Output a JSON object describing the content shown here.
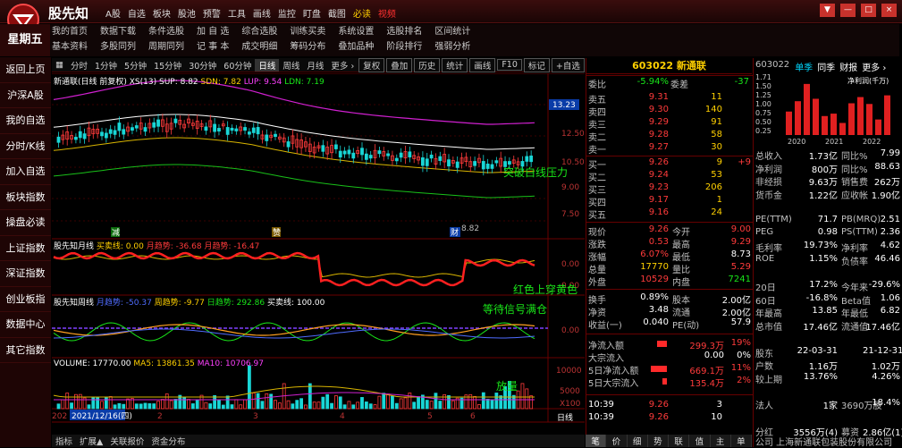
{
  "app": {
    "brand": "股先知",
    "top_menu": [
      "A股",
      "自选",
      "板块",
      "股池",
      "预警",
      "工具",
      "画线",
      "监控",
      "盯盘",
      "截图",
      "必读",
      "视频"
    ],
    "window_buttons": [
      "▼",
      "—",
      "□",
      "×"
    ]
  },
  "weekday": "星期五",
  "submenu": {
    "row1": [
      "我的首页",
      "数据下载",
      "条件选股",
      "加 自 选",
      "综合选股",
      "训练买卖",
      "系统设置",
      "选股排名",
      "区间统计"
    ],
    "row2": [
      "基本资料",
      "多股同列",
      "周期同列",
      "记 事 本",
      "成交明细",
      "筹码分布",
      "叠加品种",
      "阶段排行",
      "强弱分析"
    ]
  },
  "sidebar": [
    "返回上页",
    "沪深A股",
    "我的自选",
    "分时/K线",
    "加入自选",
    "板块指数",
    "操盘必读",
    "上证指数",
    "深证指数",
    "创业板指",
    "数据中心",
    "其它指数"
  ],
  "period_bar": {
    "items": [
      "分时",
      "1分钟",
      "5分钟",
      "15分钟",
      "30分钟",
      "60分钟",
      "日线",
      "周线",
      "月线",
      "更多 ›"
    ],
    "active": "日线",
    "buttons": [
      "复权",
      "叠加",
      "历史",
      "统计",
      "画线",
      "F10",
      "标记",
      "+自选"
    ]
  },
  "main_chart": {
    "title": "新通联(日线 前复权)",
    "indicators": [
      {
        "label": "XS(13)",
        "color": "#ffffff"
      },
      {
        "label": "SUP: 8.82",
        "color": "#ffffff"
      },
      {
        "label": "SDN: 7.82",
        "color": "#ffd000"
      },
      {
        "label": "LUP: 9.54",
        "color": "#ff40ff"
      },
      {
        "label": "LDN: 7.19",
        "color": "#19e619"
      }
    ],
    "price_labels": [
      "13.23",
      "12.50",
      "10.50",
      "9.00",
      "7.50"
    ],
    "annotations": {
      "breakout": "突破白线压力",
      "buy_mark": "减",
      "sell_mark": "赞",
      "low_mark": "8.82",
      "bottom_tag": "财"
    }
  },
  "panel1": {
    "title": "股先知月线",
    "items": [
      {
        "label": "买卖线: 0.00",
        "color": "#ffd000"
      },
      {
        "label": "月趋势: -36.68",
        "color": "#ff3b3b"
      },
      {
        "label": "月趋势: -16.47",
        "color": "#ff3b3b"
      }
    ],
    "axis": [
      "0.00",
      "0.00"
    ],
    "annotation": "红色上穿黄色"
  },
  "panel2": {
    "title": "股先知周线",
    "items": [
      {
        "label": "月趋势: -50.37",
        "color": "#4f6cff"
      },
      {
        "label": "周趋势: -9.77",
        "color": "#ffd000"
      },
      {
        "label": "日趋势: 292.86",
        "color": "#19e619"
      },
      {
        "label": "买卖线: 100.00",
        "color": "#ffffff"
      }
    ],
    "axis": [
      "0.00"
    ],
    "annotation": "等待信号满仓"
  },
  "panel3": {
    "title": "VOLUME: 17770.00",
    "items": [
      {
        "label": "MA5: 13861.35",
        "color": "#ffd000"
      },
      {
        "label": "MA10: 10706.97",
        "color": "#ff40ff"
      }
    ],
    "axis": [
      "10000",
      "5000",
      "X100"
    ],
    "annotation": "放量"
  },
  "date_axis": {
    "start": "2021/12/16(四)",
    "labels": [
      "2",
      "3",
      "4",
      "5",
      "6"
    ],
    "period": "日线",
    "year_prefix": "202"
  },
  "bottom_tabs": [
    "指标",
    "扩展▲",
    "关联报价",
    "资金分布"
  ],
  "quote": {
    "code": "603022",
    "name": "新通联",
    "webi_label": "委比",
    "webi_value": "-5.94%",
    "weicha_label": "委差",
    "weicha_value": "-37",
    "sells": [
      {
        "label": "卖五",
        "price": "9.31",
        "vol": "11"
      },
      {
        "label": "卖四",
        "price": "9.30",
        "vol": "140"
      },
      {
        "label": "卖三",
        "price": "9.29",
        "vol": "91"
      },
      {
        "label": "卖二",
        "price": "9.28",
        "vol": "58"
      },
      {
        "label": "卖一",
        "price": "9.27",
        "vol": "30"
      }
    ],
    "buys": [
      {
        "label": "买一",
        "price": "9.26",
        "vol": "9",
        "extra": "+9"
      },
      {
        "label": "买二",
        "price": "9.24",
        "vol": "53",
        "extra": ""
      },
      {
        "label": "买三",
        "price": "9.23",
        "vol": "206",
        "extra": ""
      },
      {
        "label": "买四",
        "price": "9.17",
        "vol": "1",
        "extra": ""
      },
      {
        "label": "买五",
        "price": "9.16",
        "vol": "24",
        "extra": ""
      }
    ],
    "stats": [
      {
        "l1": "现价",
        "v1": "9.26",
        "l2": "今开",
        "v2": "9.00",
        "c1": "red",
        "c2": "red"
      },
      {
        "l1": "涨跌",
        "v1": "0.53",
        "l2": "最高",
        "v2": "9.29",
        "c1": "red",
        "c2": "red"
      },
      {
        "l1": "涨幅",
        "v1": "6.07%",
        "l2": "最低",
        "v2": "8.73",
        "c1": "red",
        "c2": "wht"
      },
      {
        "l1": "总量",
        "v1": "17770",
        "l2": "量比",
        "v2": "5.29",
        "c1": "yel",
        "c2": "red"
      },
      {
        "l1": "外盘",
        "v1": "10529",
        "l2": "内盘",
        "v2": "7241",
        "c1": "red",
        "c2": "green"
      }
    ],
    "stats2": [
      {
        "l1": "换手",
        "v1": "0.89%",
        "l2": "股本",
        "v2": "2.00亿"
      },
      {
        "l1": "净资",
        "v1": "3.48",
        "l2": "流通",
        "v2": "2.00亿"
      },
      {
        "l1": "收益(一)",
        "v1": "0.040",
        "l2": "PE(动)",
        "v2": "57.9"
      }
    ],
    "flows": [
      {
        "label": "净流入额",
        "value": "299.3万",
        "pct": "19%",
        "bar": 0.6,
        "color": "red"
      },
      {
        "label": "大宗流入",
        "value": "0.00",
        "pct": "0%",
        "bar": 0,
        "color": "wht"
      },
      {
        "label": "5日净流入额",
        "value": "669.1万",
        "pct": "11%",
        "bar": 1.0,
        "color": "red"
      },
      {
        "label": "5日大宗流入",
        "value": "135.4万",
        "pct": "2%",
        "bar": 0.25,
        "color": "red"
      }
    ],
    "ticks": [
      {
        "time": "10:39",
        "price": "9.26",
        "vol": "3"
      },
      {
        "time": "10:39",
        "price": "9.26",
        "vol": "10"
      }
    ],
    "tabs": [
      "笔",
      "价",
      "细",
      "势",
      "联",
      "值",
      "主",
      "单"
    ],
    "active_tab": "笔"
  },
  "finance": {
    "code": "603022",
    "tabs": [
      "单季",
      "同季",
      "财报",
      "更多 ›"
    ],
    "chart_label": "净利润(千万)",
    "chart_data": {
      "type": "bar",
      "ylim": [
        0,
        1.71
      ],
      "y_ticks": [
        "1.71",
        "1.50",
        "1.25",
        "1.00",
        "0.75",
        "0.50",
        "0.25"
      ],
      "x_ticks": [
        "2020",
        "2021",
        "2022"
      ],
      "values": [
        0.68,
        0.98,
        1.48,
        1.05,
        0.55,
        0.62,
        0.35,
        0.92,
        1.1,
        0.9,
        0.45,
        1.15
      ]
    },
    "rows": [
      {
        "l1": "总收入",
        "v1": "1.73亿",
        "l2": "同比%",
        "v2": "7.99"
      },
      {
        "l1": "净利润",
        "v1": "800万",
        "l2": "同比%",
        "v2": "88.63"
      },
      {
        "l1": "非经损",
        "v1": "9.63万",
        "l2": "销售费",
        "v2": "262万"
      },
      {
        "l1": "货币金",
        "v1": "1.22亿",
        "l2": "应收帐",
        "v2": "1.90亿"
      },
      {
        "l1": "",
        "v1": "",
        "l2": "",
        "v2": ""
      },
      {
        "l1": "PE(TTM)",
        "v1": "71.7",
        "l2": "PB(MRQ)",
        "v2": "2.51"
      },
      {
        "l1": "PEG",
        "v1": "0.98",
        "l2": "PS(TTM)",
        "v2": "2.36"
      },
      {
        "l1": "毛利率",
        "v1": "19.73%",
        "l2": "净利率",
        "v2": "4.62"
      },
      {
        "l1": "ROE",
        "v1": "1.15%",
        "l2": "负债率",
        "v2": "46.46"
      },
      {
        "l1": "",
        "v1": "",
        "l2": "",
        "v2": ""
      },
      {
        "l1": "20日",
        "v1": "17.2%",
        "l2": "今年来",
        "v2": "-29.6%"
      },
      {
        "l1": "60日",
        "v1": "-16.8%",
        "l2": "Beta值",
        "v2": "1.06"
      },
      {
        "l1": "年最高",
        "v1": "13.85",
        "l2": "年最低",
        "v2": "6.82"
      },
      {
        "l1": "总市值",
        "v1": "17.46亿",
        "l2": "流通值",
        "v2": "17.46亿"
      },
      {
        "l1": "",
        "v1": "",
        "l2": "",
        "v2": ""
      },
      {
        "l1": "股东",
        "v1": "22-03-31",
        "l2": "",
        "v2": "21-12-31"
      },
      {
        "l1": "户数",
        "v1": "1.16万",
        "l2": "",
        "v2": "1.02万"
      },
      {
        "l1": "较上期",
        "v1": "13.76%",
        "l2": "",
        "v2": "4.26%"
      },
      {
        "l1": "",
        "v1": "",
        "l2": "",
        "v2": ""
      },
      {
        "l1": "法人",
        "v1": "1家",
        "l2": "3690万股",
        "v2": "18.4%"
      },
      {
        "l1": "",
        "v1": "",
        "l2": "",
        "v2": ""
      },
      {
        "l1": "分红",
        "v1": "3556万(4)",
        "l2": "募资",
        "v2": "2.86亿(1)"
      }
    ],
    "company": "公司 上海新通联包装股份有限公司"
  }
}
